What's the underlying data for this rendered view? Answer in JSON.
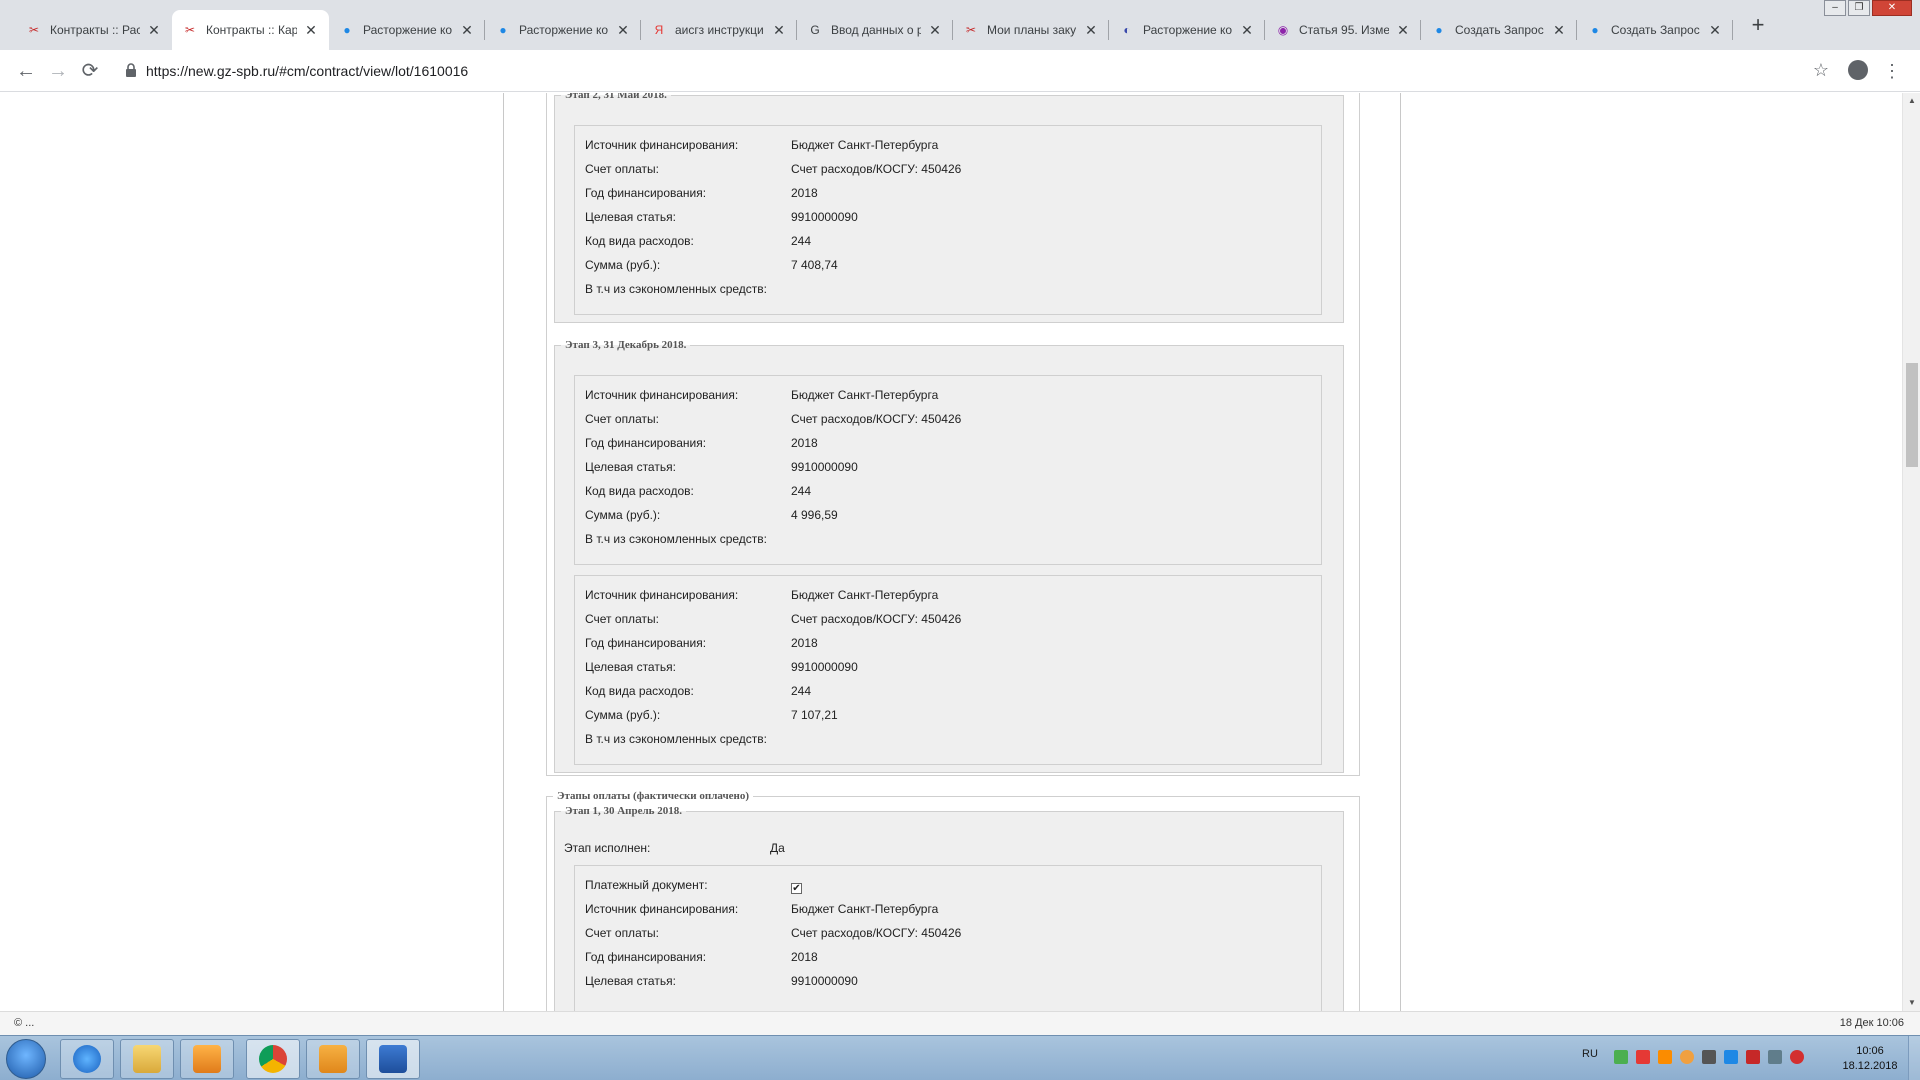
{
  "browser": {
    "tabs": [
      {
        "title": "Контракты :: Рас",
        "favicon": "tools-icon",
        "active": false
      },
      {
        "title": "Контракты :: Кар",
        "favicon": "tools-icon",
        "active": true
      },
      {
        "title": "Расторжение ко",
        "favicon": "globe-icon",
        "active": false
      },
      {
        "title": "Расторжение ко",
        "favicon": "globe-icon",
        "active": false
      },
      {
        "title": "аисгз инструкци",
        "favicon": "yandex-icon",
        "active": false
      },
      {
        "title": "Ввод данных о р",
        "favicon": "google-icon",
        "active": false
      },
      {
        "title": "Мои планы заку",
        "favicon": "tools-icon",
        "active": false
      },
      {
        "title": "Расторжение ко",
        "favicon": "doc-icon",
        "active": false
      },
      {
        "title": "Статья 95. Изме",
        "favicon": "consultant-icon",
        "active": false
      },
      {
        "title": "Создать Запрос",
        "favicon": "globe-icon",
        "active": false
      },
      {
        "title": "Создать Запрос",
        "favicon": "globe-icon",
        "active": false
      }
    ],
    "url": "https://new.gz-spb.ru/#cm/contract/view/lot/1610016",
    "accent": "#1a73e8"
  },
  "labels": {
    "source": "Источник финансирования:",
    "account": "Счет оплаты:",
    "year": "Год финансирования:",
    "article": "Целевая статья:",
    "kvr": "Код вида расходов:",
    "sum": "Сумма (руб.):",
    "savings": "В т.ч из сэкономленных средств:",
    "executed": "Этап исполнен:",
    "paydoc": "Платежный документ:"
  },
  "stage2": {
    "legend": "Этап 2, 31 Май 2018.",
    "card": {
      "source": "Бюджет Санкт-Петербурга",
      "account": "Счет расходов/КОСГУ: 450426",
      "year": "2018",
      "article": "9910000090",
      "kvr": "244",
      "sum": "7 408,74",
      "savings": ""
    }
  },
  "stage3": {
    "legend": "Этап 3, 31 Декабрь 2018.",
    "cards": [
      {
        "source": "Бюджет Санкт-Петербурга",
        "account": "Счет расходов/КОСГУ: 450426",
        "year": "2018",
        "article": "9910000090",
        "kvr": "244",
        "sum": "4 996,59",
        "savings": ""
      },
      {
        "source": "Бюджет Санкт-Петербурга",
        "account": "Счет расходов/КОСГУ: 450426",
        "year": "2018",
        "article": "9910000090",
        "kvr": "244",
        "sum": "7 107,21",
        "savings": ""
      }
    ]
  },
  "paid": {
    "legend": "Этапы оплаты (фактически оплачено)",
    "stage1": {
      "legend": "Этап 1, 30 Апрель 2018.",
      "executed": "Да",
      "card": {
        "paydoc_checked": true,
        "source": "Бюджет Санкт-Петербурга",
        "account": "Счет расходов/КОСГУ: 450426",
        "year": "2018",
        "article": "9910000090"
      }
    }
  },
  "status": {
    "left": "© ...",
    "right": "18 Дек 10:06"
  },
  "taskbar": {
    "apps": [
      "internet-explorer-icon",
      "file-explorer-icon",
      "media-player-icon",
      "chrome-icon",
      "outlook-icon",
      "word-icon"
    ],
    "lang": "RU",
    "time": "10:06",
    "date": "18.12.2018"
  }
}
